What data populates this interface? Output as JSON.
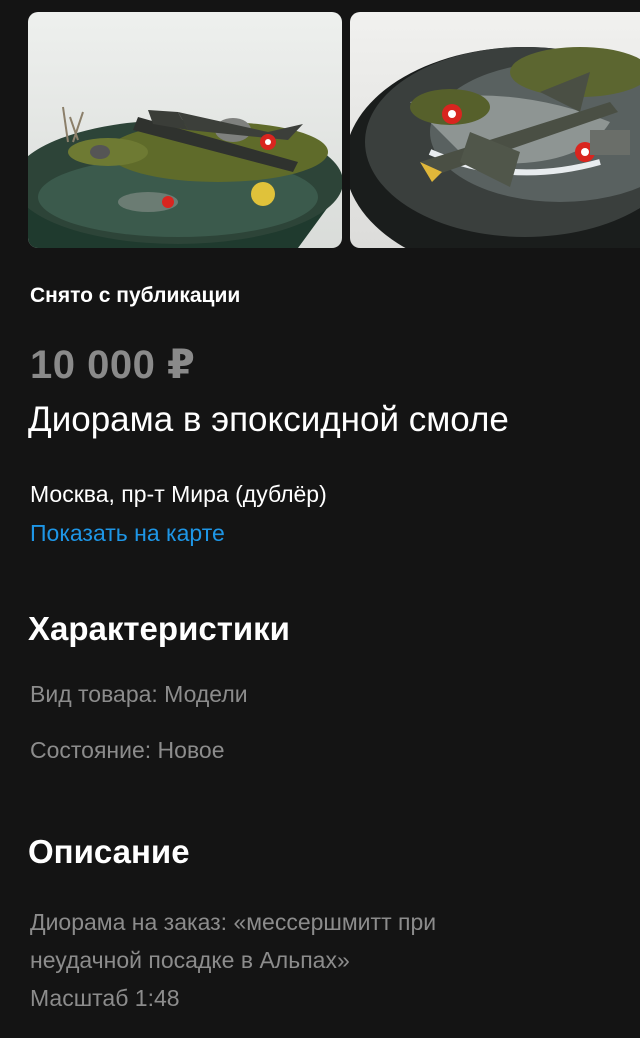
{
  "gallery": {
    "photos": [
      {
        "icon": "diorama-photo-1"
      },
      {
        "icon": "diorama-photo-2"
      }
    ]
  },
  "listing": {
    "status": "Снято с публикации",
    "price": "10 000 ₽",
    "title": "Диорама в эпоксидной смоле",
    "address": "Москва, пр-т Мира (дублёр)",
    "map_link": "Показать на карте",
    "link_color": "#1e96e6"
  },
  "specs": {
    "heading": "Характеристики",
    "items": [
      "Вид товара: Модели",
      "Состояние: Новое"
    ]
  },
  "description": {
    "heading": "Описание",
    "text": "Диорама на заказ: «мессершмитт при\nнеудачной посадке в Альпах»\nМасштаб 1:48"
  }
}
